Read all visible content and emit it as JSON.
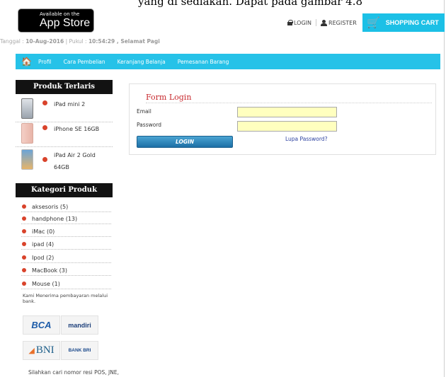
{
  "caption_fragment": "yang di sediakan. Dapat pada gambar 4.8",
  "header": {
    "appstore_small": "Available on the",
    "appstore_big": "App Store",
    "date_prefix": "Tanggal : ",
    "date": "10-Aug-2016",
    "time_prefix": " | Pukul : ",
    "time": "10:54:29",
    "greeting": " , Selamat Pagi",
    "login_label": "LOGIN",
    "register_label": "REGISTER",
    "cart_label": "SHOPPING CART"
  },
  "nav": {
    "items": [
      "Profil",
      "Cara Pembelian",
      "Keranjang Belanja",
      "Pemesanan Barang"
    ]
  },
  "sidebar": {
    "bestseller_title": "Produk Terlaris",
    "bestsellers": [
      {
        "name": "iPad mini 2"
      },
      {
        "name": "iPhone SE 16GB"
      },
      {
        "name": "iPad Air 2 Gold 64GB"
      }
    ],
    "category_title": "Kategori Produk",
    "categories": [
      "aksesoris (5)",
      "handphone (13)",
      "iMac (0)",
      "ipad (4)",
      "Ipod (2)",
      "MacBook (3)",
      "Mouse (1)"
    ],
    "payment_note": "Kami Menerima pembayaran melalui bank.",
    "banks": [
      "BCA",
      "mandiri",
      "BNI",
      "BANK BRI"
    ],
    "resi_note": "Silahkan cari nomor resi POS, JNE,"
  },
  "login": {
    "title": "Form Login",
    "email_label": "Email",
    "password_label": "Password",
    "email_value": "",
    "password_value": "",
    "button_label": "LOGIN",
    "forgot_label": "Lupa Password?"
  },
  "colors": {
    "accent": "#26c2e8",
    "title_red": "#c7282d",
    "bullet_red": "#d9432b",
    "field_bg": "#ffffbf",
    "bank_blue": "#1c5ba8"
  }
}
